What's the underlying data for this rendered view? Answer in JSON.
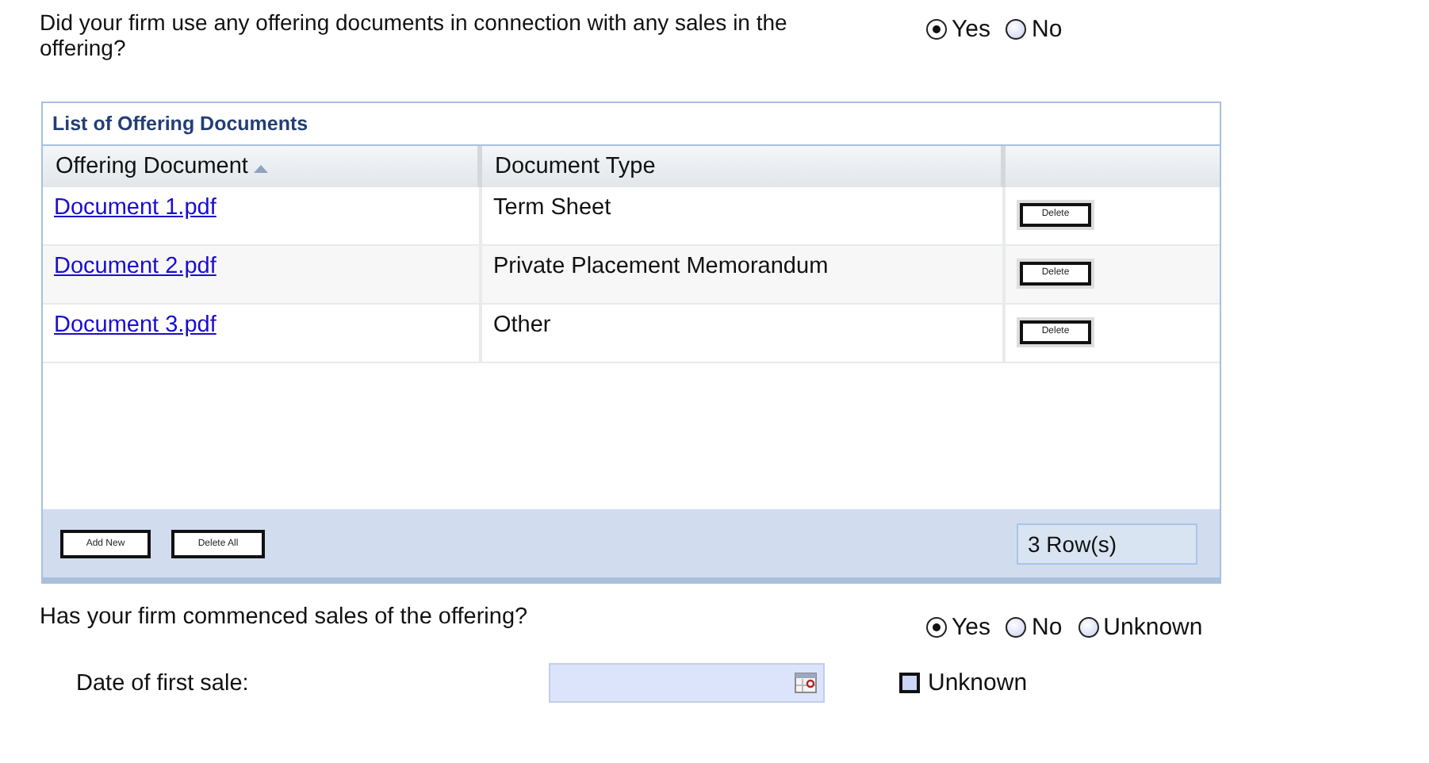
{
  "question_1": {
    "text": "Did your firm use any offering documents in connection with any sales in the offering?",
    "options": [
      {
        "label": "Yes",
        "selected": true
      },
      {
        "label": "No",
        "selected": false
      }
    ]
  },
  "documents_table": {
    "title": "List of Offering Documents",
    "columns": [
      {
        "label": "Offering Document",
        "sorted": true
      },
      {
        "label": "Document Type",
        "sorted": false
      }
    ],
    "rows": [
      {
        "document": "Document 1.pdf",
        "type": "Term Sheet",
        "action": "Delete"
      },
      {
        "document": "Document 2.pdf",
        "type": "Private Placement Memorandum",
        "action": "Delete"
      },
      {
        "document": "Document 3.pdf",
        "type": "Other",
        "action": "Delete"
      }
    ],
    "buttons": [
      "Add New",
      "Delete All"
    ],
    "row_count": "3 Row(s)"
  },
  "question_2": {
    "text": "Has your firm commenced sales of the offering?",
    "options": [
      {
        "label": "Yes",
        "selected": true
      },
      {
        "label": "No",
        "selected": false
      },
      {
        "label": "Unknown",
        "selected": false
      }
    ]
  },
  "date_of_first_sale": {
    "label": "Date of first sale:",
    "unknown": {
      "label": "Unknown",
      "checked": false
    }
  }
}
